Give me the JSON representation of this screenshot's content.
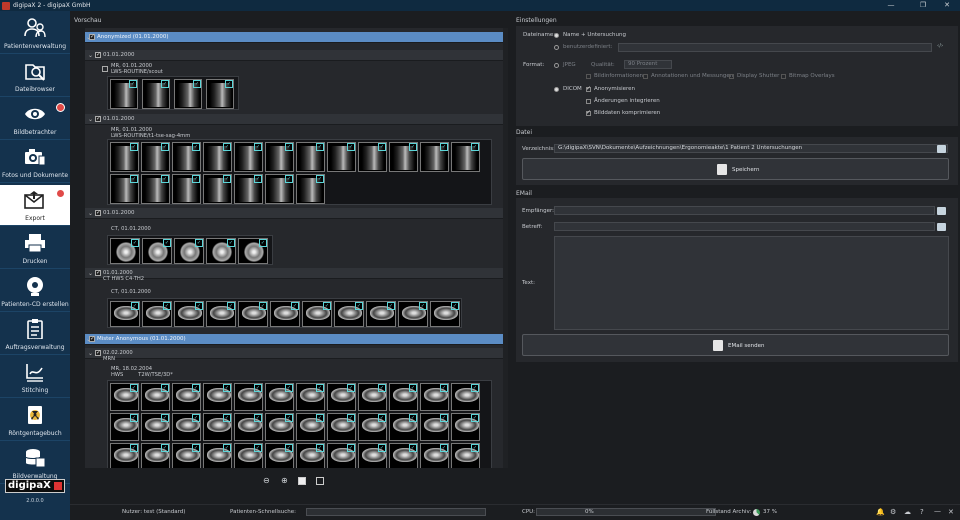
{
  "window": {
    "title": "digipaX 2 - digipaX GmbH",
    "min": "—",
    "restore": "❐",
    "close": "✕"
  },
  "sidebar": {
    "items": [
      {
        "label": "Patientenverwaltung",
        "icon": "patients-icon"
      },
      {
        "label": "Dateibrowser",
        "icon": "folder-search-icon"
      },
      {
        "label": "Bildbetrachter",
        "icon": "eye-icon",
        "badge": "5"
      },
      {
        "label": "Fotos und Dokumente",
        "icon": "camera-icon"
      },
      {
        "label": "Export",
        "icon": "export-envelope-icon",
        "badge": "2",
        "active": true
      },
      {
        "label": "Drucken",
        "icon": "printer-icon"
      },
      {
        "label": "Patienten-CD erstellen",
        "icon": "cd-icon"
      },
      {
        "label": "Auftragsverwaltung",
        "icon": "clipboard-icon"
      },
      {
        "label": "Stitching",
        "icon": "stitching-icon"
      },
      {
        "label": "Röntgentagebuch",
        "icon": "radiation-icon"
      },
      {
        "label": "Bildverwaltung",
        "icon": "database-icon"
      }
    ],
    "logo": "digipaX",
    "version": "2.0.0.0"
  },
  "preview": {
    "header": "Vorschau",
    "patient1": "Anonymized (01.01.2000)",
    "p1_study1_date": "01.01.2000",
    "p1_s1_series": "MR, 01.01.2000\nLWS-ROUTINE/scout",
    "p1_study2_date": "01.01.2000",
    "p1_s2_series": "MR, 01.01.2000\nLWS-ROUTINE/t1-tse-sag-4mm",
    "p1_study3_date": "01.01.2000",
    "p1_s3_series": "CT, 01.01.2000",
    "p1_study4_date": "01.01.2000\nCT HWS C4-TH2",
    "p1_s4_series": "CT, 01.01.2000",
    "patient2": "Mister Anonymous (01.01.2000)",
    "p2_study1_date": "02.02.2000\nMRN",
    "p2_s1_series": "MR, 18.02.2004\nHWS         T2W/TSE/3D*",
    "zoom_out": "🔍",
    "zoom_in": "🔍"
  },
  "settings": {
    "header": "Einstellungen",
    "dateiname_label": "Dateiname:",
    "opt_name": "Name + Untersuchung",
    "opt_custom": "benutzerdefiniert:",
    "format_label": "Format:",
    "jpeg": "JPEG",
    "qualitaet": "Qualität:",
    "qualitaet_value": "90 Prozent",
    "bildinfo": "Bildinformationen",
    "annotationen": "Annotationen und Messungen",
    "shutter": "Display Shutter",
    "overlays": "Bitmap Overlays",
    "dicom": "DICOM",
    "anonym": "Anonymisieren",
    "aenderungen": "Änderungen integrieren",
    "komprimieren": "Bilddaten komprimieren"
  },
  "datei": {
    "header": "Datei",
    "verzeichnis_label": "Verzeichnis:",
    "verzeichnis_value": "G:\\digipaX\\SVN\\Dokumente\\Aufzeichnungen\\Ergonomieakte\\1 Patient 2 Untersuchungen",
    "speichern": "Speichern"
  },
  "email": {
    "header": "EMail",
    "empfaenger_label": "Empfänger:",
    "betreff_label": "Betreff:",
    "text_label": "Text:",
    "senden": "EMail senden"
  },
  "status": {
    "nutzer": "Nutzer: test (Standard)",
    "schnellsuche": "Patienten-Schnellsuche:",
    "cpu_label": "CPU:",
    "cpu_value": "0%",
    "fuellstand": "Füllstand Archiv:",
    "fuellstand_value": "37 %"
  }
}
